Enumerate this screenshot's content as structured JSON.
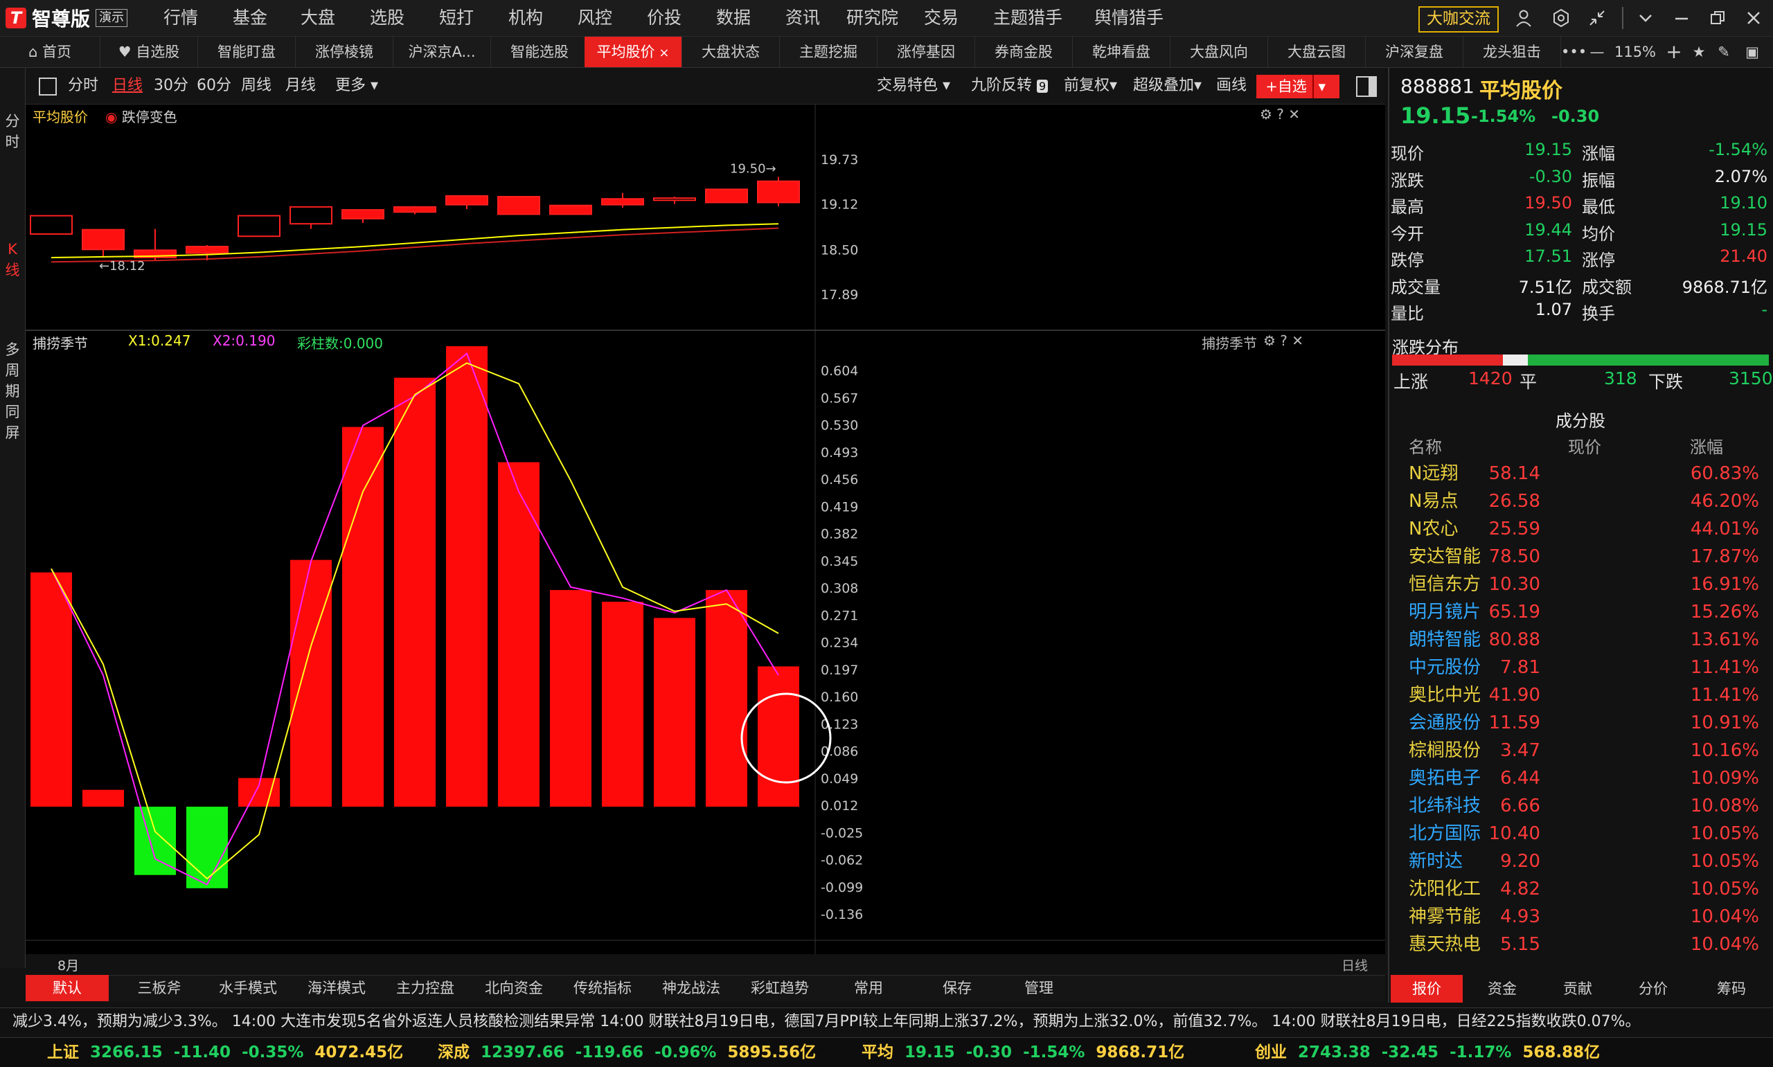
{
  "app": {
    "logo_text": "智尊版",
    "demo_badge": "演示",
    "menu": [
      "行情",
      "基金",
      "大盘",
      "选股",
      "短打",
      "机构",
      "风控",
      "价投",
      "数据",
      "资讯",
      "研究院",
      "交易",
      "主题猎手",
      "舆情猎手"
    ],
    "daka_label": "大咖交流",
    "colors": {
      "accent": "#e8201e",
      "up": "#ff3030",
      "down": "#20d060",
      "ma1": "#ffff00",
      "ma2": "#ff20ff"
    }
  },
  "tabs": [
    "首页",
    "自选股",
    "智能盯盘",
    "涨停棱镜",
    "沪深京A...",
    "智能选股",
    "平均股价",
    "大盘状态",
    "主题挖掘",
    "涨停基因",
    "券商金股",
    "乾坤看盘",
    "大盘风向",
    "大盘云图",
    "沪深复盘",
    "龙头狙击"
  ],
  "zoom": "115%",
  "left_strip": {
    "fenshi": "分时",
    "kxian": "K线",
    "multi": "多周期同屏"
  },
  "chart_toolbar": {
    "periods": [
      "分时",
      "日线",
      "30分",
      "60分",
      "周线",
      "月线",
      "更多"
    ],
    "selected": "日线",
    "right": [
      "交易特色",
      "九阶反转",
      "前复权",
      "超级叠加",
      "画线"
    ],
    "nine_badge": "9",
    "add_fav": "+自选"
  },
  "kline": {
    "title": "平均股价",
    "option": "跌停变色",
    "high_label": "19.50",
    "low_label": "18.12",
    "y_ticks": [
      "19.73",
      "19.12",
      "18.50",
      "17.89"
    ],
    "chart_data": {
      "type": "candlestick",
      "y_range": [
        17.89,
        19.73
      ],
      "candles": [
        {
          "o": 18.72,
          "c": 18.97,
          "h": 18.97,
          "l": 18.72
        },
        {
          "o": 18.78,
          "c": 18.51,
          "h": 18.78,
          "l": 18.4
        },
        {
          "o": 18.5,
          "c": 18.4,
          "h": 18.79,
          "l": 18.36
        },
        {
          "o": 18.55,
          "c": 18.46,
          "h": 18.57,
          "l": 18.36
        },
        {
          "o": 18.69,
          "c": 18.97,
          "h": 18.97,
          "l": 18.69
        },
        {
          "o": 18.86,
          "c": 19.09,
          "h": 19.09,
          "l": 18.79
        },
        {
          "o": 19.05,
          "c": 18.93,
          "h": 19.05,
          "l": 18.87
        },
        {
          "o": 19.09,
          "c": 19.02,
          "h": 19.1,
          "l": 18.99
        },
        {
          "o": 19.24,
          "c": 19.12,
          "h": 19.24,
          "l": 19.06
        },
        {
          "o": 19.23,
          "c": 18.99,
          "h": 19.24,
          "l": 18.99
        },
        {
          "o": 19.11,
          "c": 18.99,
          "h": 19.11,
          "l": 18.99
        },
        {
          "o": 19.2,
          "c": 19.12,
          "h": 19.28,
          "l": 19.08
        },
        {
          "o": 19.18,
          "c": 19.21,
          "h": 19.23,
          "l": 19.13
        },
        {
          "o": 19.33,
          "c": 19.15,
          "h": 19.33,
          "l": 19.15
        },
        {
          "o": 19.44,
          "c": 19.15,
          "h": 19.5,
          "l": 19.1
        }
      ],
      "ma_yellow": [
        18.4,
        18.41,
        18.42,
        18.44,
        18.47,
        18.51,
        18.55,
        18.6,
        18.65,
        18.7,
        18.74,
        18.78,
        18.81,
        18.84,
        18.86
      ],
      "ma_red": [
        18.34,
        18.35,
        18.36,
        18.38,
        18.41,
        18.45,
        18.49,
        18.54,
        18.59,
        18.63,
        18.67,
        18.71,
        18.74,
        18.77,
        18.8
      ]
    }
  },
  "indicator": {
    "name": "捕捞季节",
    "x1": "X1:0.247",
    "x2": "X2:0.190",
    "caizhu": "彩柱数:0.000",
    "y_ticks": [
      "0.604",
      "0.567",
      "0.530",
      "0.493",
      "0.456",
      "0.419",
      "0.382",
      "0.345",
      "0.308",
      "0.271",
      "0.234",
      "0.197",
      "0.160",
      "0.123",
      "0.086",
      "0.049",
      "0.012",
      "-0.025",
      "-0.062",
      "-0.099",
      "-0.136"
    ],
    "x_label": "8月",
    "axis_tag": "日线",
    "chart_data": {
      "type": "bar",
      "y_range": [
        -0.14,
        0.62
      ],
      "values": [
        0.33,
        0.034,
        -0.082,
        -0.1,
        0.05,
        0.347,
        0.528,
        0.595,
        0.638,
        0.48,
        0.306,
        0.29,
        0.268,
        0.306,
        0.202
      ],
      "series": [
        {
          "name": "X1",
          "values": [
            0.335,
            0.205,
            -0.023,
            -0.087,
            -0.027,
            0.23,
            0.44,
            0.572,
            0.615,
            0.587,
            0.455,
            0.31,
            0.277,
            0.287,
            0.247
          ]
        },
        {
          "name": "X2",
          "values": [
            0.335,
            0.19,
            -0.06,
            -0.095,
            0.04,
            0.345,
            0.53,
            0.57,
            0.628,
            0.44,
            0.31,
            0.295,
            0.275,
            0.306,
            0.19
          ]
        }
      ]
    }
  },
  "bottom_tabs": [
    "默认",
    "三板斧",
    "水手模式",
    "海洋模式",
    "主力控盘",
    "北向资金",
    "传统指标",
    "神龙战法",
    "彩虹趋势",
    "常用",
    "保存",
    "管理"
  ],
  "quote": {
    "code": "888881",
    "name": "平均股价",
    "price": "19.15",
    "change_pct": "-1.54%",
    "change": "-0.30",
    "fields": [
      [
        "现价",
        "19.15",
        "涨幅",
        "-1.54%"
      ],
      [
        "涨跌",
        "-0.30",
        "振幅",
        "2.07%"
      ],
      [
        "最高",
        "19.50",
        "最低",
        "19.10"
      ],
      [
        "今开",
        "19.44",
        "均价",
        "19.15"
      ],
      [
        "跌停",
        "17.51",
        "涨停",
        "21.40"
      ],
      [
        "成交量",
        "7.51亿",
        "成交额",
        "9868.71亿"
      ],
      [
        "量比",
        "1.07",
        "换手",
        "-"
      ]
    ],
    "dist_title": "涨跌分布",
    "up_label": "上涨",
    "up_count": "1420",
    "flat_label": "平",
    "flat_count": "318",
    "down_label": "下跌",
    "down_count": "3150",
    "list_title": "成分股",
    "list_headers": [
      "名称",
      "现价",
      "涨幅"
    ],
    "stocks": [
      {
        "name": "N远翔",
        "price": "58.14",
        "pct": "60.83%",
        "c": "yl"
      },
      {
        "name": "N易点",
        "price": "26.58",
        "pct": "46.20%",
        "c": "yl"
      },
      {
        "name": "N农心",
        "price": "25.59",
        "pct": "44.01%",
        "c": "yl"
      },
      {
        "name": "安达智能",
        "price": "78.50",
        "pct": "17.87%",
        "c": "yl"
      },
      {
        "name": "恒信东方",
        "price": "10.30",
        "pct": "16.91%",
        "c": "yl"
      },
      {
        "name": "明月镜片",
        "price": "65.19",
        "pct": "15.26%",
        "c": "bl"
      },
      {
        "name": "朗特智能",
        "price": "80.88",
        "pct": "13.61%",
        "c": "bl"
      },
      {
        "name": "中元股份",
        "price": "7.81",
        "pct": "11.41%",
        "c": "bl"
      },
      {
        "name": "奥比中光",
        "price": "41.90",
        "pct": "11.41%",
        "c": "yl"
      },
      {
        "name": "会通股份",
        "price": "11.59",
        "pct": "10.91%",
        "c": "bl"
      },
      {
        "name": "棕榈股份",
        "price": "3.47",
        "pct": "10.16%",
        "c": "yl"
      },
      {
        "name": "奥拓电子",
        "price": "6.44",
        "pct": "10.09%",
        "c": "bl"
      },
      {
        "name": "北纬科技",
        "price": "6.66",
        "pct": "10.08%",
        "c": "bl"
      },
      {
        "name": "北方国际",
        "price": "10.40",
        "pct": "10.05%",
        "c": "bl"
      },
      {
        "name": "新时达",
        "price": "9.20",
        "pct": "10.05%",
        "c": "bl"
      },
      {
        "name": "沈阳化工",
        "price": "4.82",
        "pct": "10.05%",
        "c": "yl"
      },
      {
        "name": "神雾节能",
        "price": "4.93",
        "pct": "10.04%",
        "c": "yl"
      },
      {
        "name": "惠天热电",
        "price": "5.15",
        "pct": "10.04%",
        "c": "yl"
      }
    ],
    "tabs": [
      "报价",
      "资金",
      "贡献",
      "分价",
      "筹码"
    ]
  },
  "ticker": "减少3.4%，预期为减少3.3%。      14:00 大连市发现5名省外返连人员核酸检测结果异常      14:00 财联社8月19日电，德国7月PPI较上年同期上涨37.2%，预期为上涨32.0%，前值32.7%。      14:00 财联社8月19日电，日经225指数收跌0.07%。",
  "indices": [
    {
      "name": "上证",
      "price": "3266.15",
      "chg": "-11.40",
      "pct": "-0.35%",
      "amt": "4072.45亿"
    },
    {
      "name": "深成",
      "price": "12397.66",
      "chg": "-119.66",
      "pct": "-0.96%",
      "amt": "5895.56亿"
    },
    {
      "name": "平均",
      "price": "19.15",
      "chg": "-0.30",
      "pct": "-1.54%",
      "amt": "9868.71亿"
    },
    {
      "name": "创业",
      "price": "2743.38",
      "chg": "-32.45",
      "pct": "-1.17%",
      "amt": "568.88亿"
    }
  ]
}
